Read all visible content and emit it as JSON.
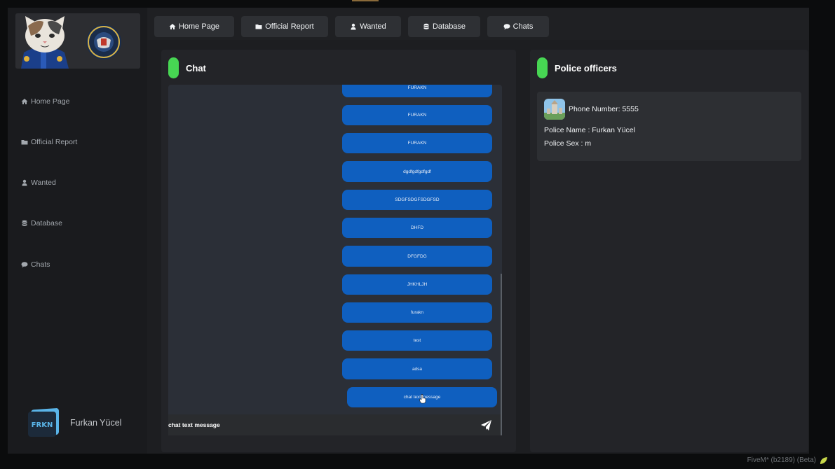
{
  "sidebar": {
    "items": [
      {
        "label": "Home Page",
        "icon": "home-icon"
      },
      {
        "label": "Official Report",
        "icon": "folder-icon"
      },
      {
        "label": "Wanted",
        "icon": "user-icon"
      },
      {
        "label": "Database",
        "icon": "database-icon"
      },
      {
        "label": "Chats",
        "icon": "comment-icon"
      }
    ],
    "user_name": "Furkan Yücel",
    "brand_text": "FRKN"
  },
  "topnav": {
    "items": [
      {
        "label": "Home Page",
        "icon": "home-icon"
      },
      {
        "label": "Official Report",
        "icon": "folder-icon"
      },
      {
        "label": "Wanted",
        "icon": "user-icon"
      },
      {
        "label": "Database",
        "icon": "database-icon"
      },
      {
        "label": "Chats",
        "icon": "comment-icon"
      }
    ]
  },
  "chat": {
    "title": "Chat",
    "messages": [
      "FURAKN",
      "FURAKN",
      "FURAKN",
      "dgdfgdfgdfgdf",
      "SDGFSDGFSDGFSD",
      "DHFD",
      "DFGFDG",
      "JHKHLJH",
      "furakn",
      "test",
      "adsa",
      "chat text message"
    ],
    "input_value": "chat text message"
  },
  "officers": {
    "title": "Police officers",
    "list": [
      {
        "phone_label": "Phone Number",
        "phone": "5555",
        "name_label": "Police Name",
        "name": "Furkan Yücel",
        "sex_label": "Police Sex",
        "sex": "m"
      }
    ]
  },
  "footer": {
    "text": "FiveM* (b2189) (Beta)"
  },
  "colors": {
    "accent_green": "#47d653",
    "message_blue": "#0f5fbf",
    "panel": "#232428"
  }
}
